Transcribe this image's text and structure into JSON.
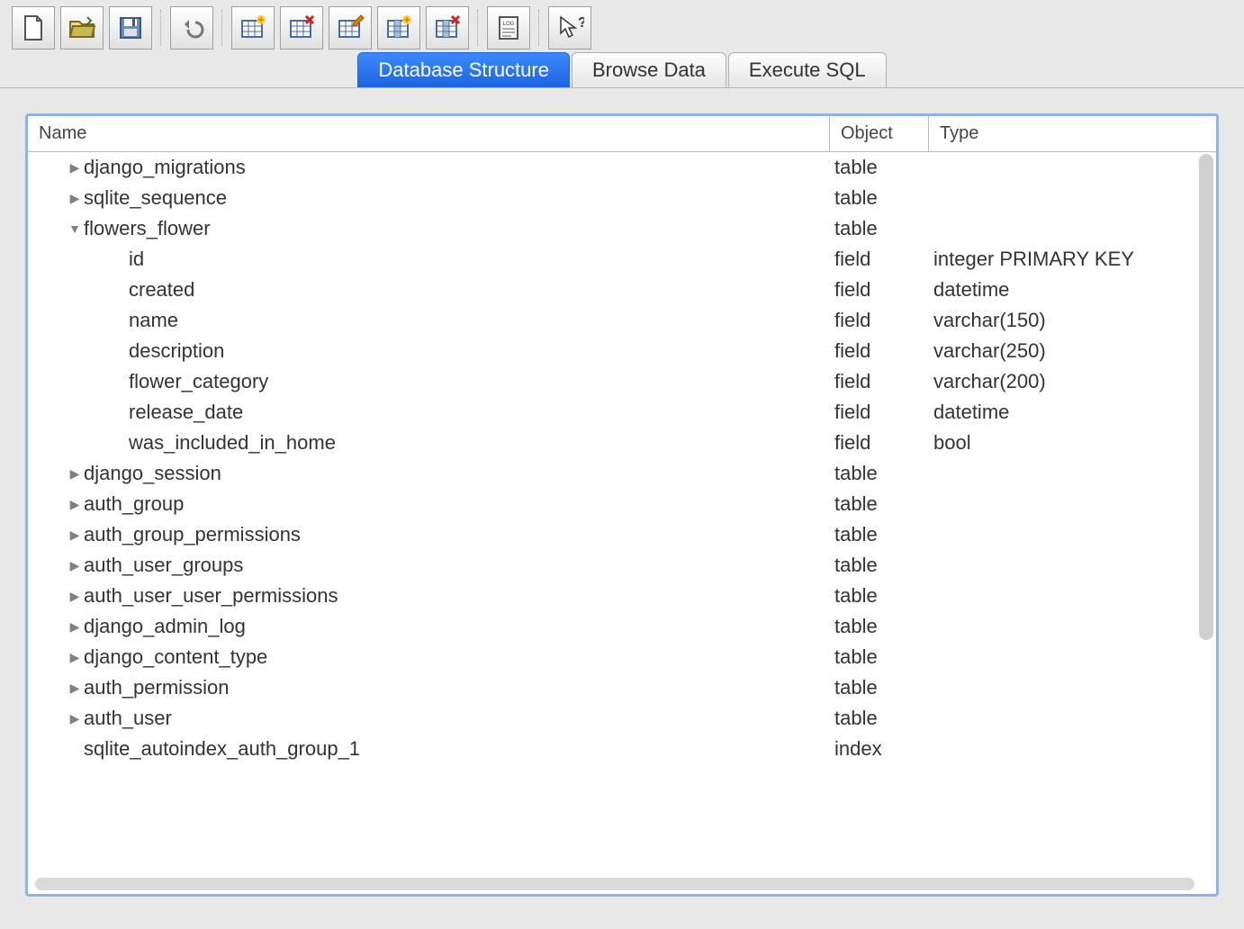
{
  "toolbar": {
    "icons": [
      "new-file",
      "open-folder",
      "save",
      "undo",
      "table-new",
      "table-delete",
      "table-edit",
      "column-new",
      "column-delete",
      "log",
      "pointer-help"
    ]
  },
  "tabs": [
    {
      "label": "Database Structure",
      "active": true
    },
    {
      "label": "Browse Data",
      "active": false
    },
    {
      "label": "Execute SQL",
      "active": false
    }
  ],
  "columns": {
    "name": "Name",
    "object": "Object",
    "type": "Type"
  },
  "rows": [
    {
      "name": "django_migrations",
      "object": "table",
      "type": "",
      "expand": "collapsed",
      "indent": 0
    },
    {
      "name": "sqlite_sequence",
      "object": "table",
      "type": "",
      "expand": "collapsed",
      "indent": 0
    },
    {
      "name": "flowers_flower",
      "object": "table",
      "type": "",
      "expand": "expanded",
      "indent": 0
    },
    {
      "name": "id",
      "object": "field",
      "type": "integer PRIMARY KEY",
      "expand": "none",
      "indent": 1
    },
    {
      "name": "created",
      "object": "field",
      "type": "datetime",
      "expand": "none",
      "indent": 1
    },
    {
      "name": "name",
      "object": "field",
      "type": "varchar(150)",
      "expand": "none",
      "indent": 1
    },
    {
      "name": "description",
      "object": "field",
      "type": "varchar(250)",
      "expand": "none",
      "indent": 1
    },
    {
      "name": "flower_category",
      "object": "field",
      "type": "varchar(200)",
      "expand": "none",
      "indent": 1
    },
    {
      "name": "release_date",
      "object": "field",
      "type": "datetime",
      "expand": "none",
      "indent": 1
    },
    {
      "name": "was_included_in_home",
      "object": "field",
      "type": "bool",
      "expand": "none",
      "indent": 1
    },
    {
      "name": "django_session",
      "object": "table",
      "type": "",
      "expand": "collapsed",
      "indent": 0
    },
    {
      "name": "auth_group",
      "object": "table",
      "type": "",
      "expand": "collapsed",
      "indent": 0
    },
    {
      "name": "auth_group_permissions",
      "object": "table",
      "type": "",
      "expand": "collapsed",
      "indent": 0
    },
    {
      "name": "auth_user_groups",
      "object": "table",
      "type": "",
      "expand": "collapsed",
      "indent": 0
    },
    {
      "name": "auth_user_user_permissions",
      "object": "table",
      "type": "",
      "expand": "collapsed",
      "indent": 0
    },
    {
      "name": "django_admin_log",
      "object": "table",
      "type": "",
      "expand": "collapsed",
      "indent": 0
    },
    {
      "name": "django_content_type",
      "object": "table",
      "type": "",
      "expand": "collapsed",
      "indent": 0
    },
    {
      "name": "auth_permission",
      "object": "table",
      "type": "",
      "expand": "collapsed",
      "indent": 0
    },
    {
      "name": "auth_user",
      "object": "table",
      "type": "",
      "expand": "collapsed",
      "indent": 0
    },
    {
      "name": "sqlite_autoindex_auth_group_1",
      "object": "index",
      "type": "",
      "expand": "none",
      "indent": 0
    }
  ]
}
